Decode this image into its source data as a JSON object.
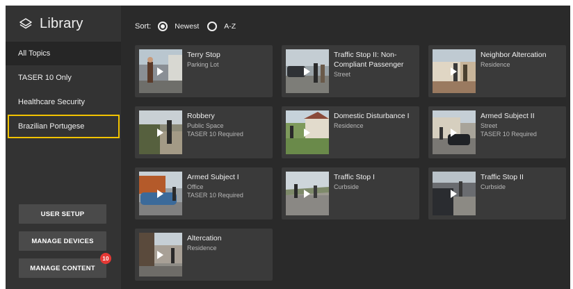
{
  "sidebar": {
    "title": "Library",
    "topics": [
      {
        "label": "All Topics"
      },
      {
        "label": "TASER 10 Only"
      },
      {
        "label": "Healthcare Security"
      },
      {
        "label": "Brazilian Portugese"
      }
    ],
    "buttons": {
      "user_setup": "USER SETUP",
      "manage_devices": "MANAGE DEVICES",
      "manage_content": "MANAGE CONTENT",
      "manage_content_badge": "10"
    }
  },
  "sort": {
    "label": "Sort:",
    "options": [
      "Newest",
      "A-Z"
    ],
    "selected": "Newest"
  },
  "scenarios": [
    {
      "title": "Terry Stop",
      "location": "Parking Lot",
      "requirement": ""
    },
    {
      "title": "Traffic Stop II: Non-Compliant Passenger",
      "location": "Street",
      "requirement": ""
    },
    {
      "title": "Neighbor Altercation",
      "location": "Residence",
      "requirement": ""
    },
    {
      "title": "Robbery",
      "location": "Public Space",
      "requirement": "TASER 10 Required"
    },
    {
      "title": "Domestic Disturbance I",
      "location": "Residence",
      "requirement": ""
    },
    {
      "title": "Armed Subject II",
      "location": "Street",
      "requirement": "TASER 10 Required"
    },
    {
      "title": "Armed Subject I",
      "location": "Office",
      "requirement": "TASER 10 Required"
    },
    {
      "title": "Traffic Stop I",
      "location": "Curbside",
      "requirement": ""
    },
    {
      "title": "Traffic Stop II",
      "location": "Curbside",
      "requirement": ""
    },
    {
      "title": "Altercation",
      "location": "Residence",
      "requirement": ""
    }
  ],
  "colors": {
    "background": "#2a2a2a",
    "sidebar": "#333333",
    "card": "#3a3a3a",
    "highlight": "#f2c300",
    "badge": "#e53935"
  },
  "icons": {
    "library": "layers-icon",
    "play": "play-icon"
  }
}
